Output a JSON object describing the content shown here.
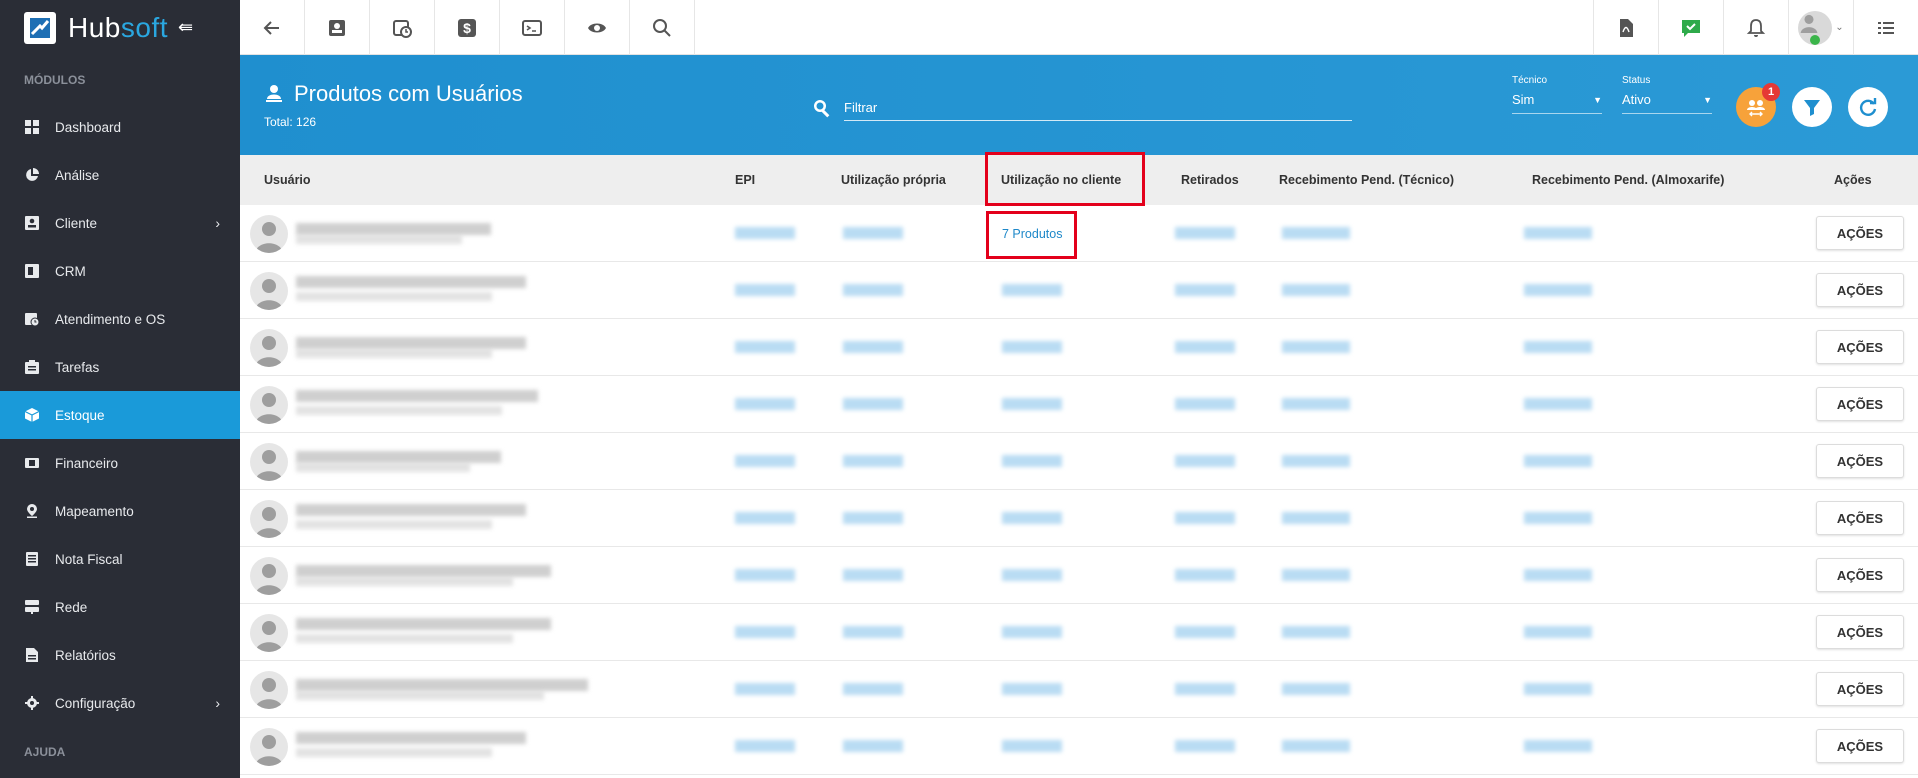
{
  "brand": {
    "name_a": "Hub",
    "name_b": "soft"
  },
  "sidebar": {
    "section_modules": "MÓDULOS",
    "section_help": "AJUDA",
    "items": [
      {
        "label": "Dashboard",
        "icon": "dashboard-icon"
      },
      {
        "label": "Análise",
        "icon": "pie-chart-icon"
      },
      {
        "label": "Cliente",
        "icon": "contact-card-icon",
        "has_submenu": true
      },
      {
        "label": "CRM",
        "icon": "crm-icon"
      },
      {
        "label": "Atendimento e OS",
        "icon": "calendar-clock-icon"
      },
      {
        "label": "Tarefas",
        "icon": "tasks-icon"
      },
      {
        "label": "Estoque",
        "icon": "box-icon",
        "active": true
      },
      {
        "label": "Financeiro",
        "icon": "money-icon"
      },
      {
        "label": "Mapeamento",
        "icon": "map-pin-icon"
      },
      {
        "label": "Nota Fiscal",
        "icon": "invoice-icon"
      },
      {
        "label": "Rede",
        "icon": "network-icon"
      },
      {
        "label": "Relatórios",
        "icon": "report-icon"
      },
      {
        "label": "Configuração",
        "icon": "gear-icon",
        "has_submenu": true
      }
    ]
  },
  "header": {
    "title": "Produtos com Usuários",
    "total": "Total: 126",
    "filter_placeholder": "Filtrar",
    "tecnico": {
      "label": "Técnico",
      "value": "Sim"
    },
    "status": {
      "label": "Status",
      "value": "Ativo"
    },
    "badge_count": "1"
  },
  "table": {
    "columns": [
      "Usuário",
      "EPI",
      "Utilização própria",
      "Utilização no cliente",
      "Retirados",
      "Recebimento Pend. (Técnico)",
      "Recebimento Pend. (Almoxarife)",
      "Ações"
    ],
    "first_row_link": "7 Produtos",
    "action_label": "AÇÕES",
    "row_count": 10
  },
  "colors": {
    "sidebar_bg": "#2a2d36",
    "active_item": "#1a9ad9",
    "header_blue": "#2494d2",
    "highlight_red": "#e3001b",
    "link_blue": "#1e88c9"
  }
}
